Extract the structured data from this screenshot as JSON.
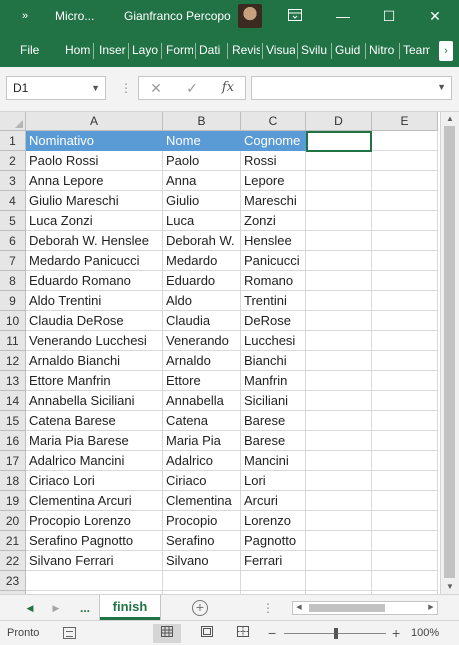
{
  "titlebar": {
    "qat_label": "»",
    "app_title": "Micro...",
    "user_name": "Gianfranco Percopo",
    "ribbon_display_icon": "ribbon-display-icon",
    "minimize_glyph": "—",
    "maximize_glyph": "☐",
    "close_glyph": "✕"
  },
  "ribbon": {
    "tabs": [
      "File",
      "Hom",
      "Inser",
      "Layo",
      "Form",
      "Dati",
      "Revis",
      "Visua",
      "Svilu",
      "Guid",
      "Nitro",
      "Team"
    ],
    "scroll_glyph": "›"
  },
  "formula_bar": {
    "name_box": "D1",
    "cancel_glyph": "✕",
    "enter_glyph": "✓",
    "function_glyph": "fx",
    "formula_value": ""
  },
  "columns": [
    "A",
    "B",
    "C",
    "D",
    "E"
  ],
  "rows": [
    [
      "Nominativo",
      "Nome",
      "Cognome",
      "",
      ""
    ],
    [
      "Paolo Rossi",
      "Paolo",
      "Rossi",
      "",
      ""
    ],
    [
      "Anna Lepore",
      "Anna",
      "Lepore",
      "",
      ""
    ],
    [
      "Giulio Mareschi",
      "Giulio",
      "Mareschi",
      "",
      ""
    ],
    [
      "Luca Zonzi",
      "Luca",
      "Zonzi",
      "",
      ""
    ],
    [
      "Deborah W. Henslee",
      "Deborah W.",
      "Henslee",
      "",
      ""
    ],
    [
      "Medardo Panicucci",
      "Medardo",
      "Panicucci",
      "",
      ""
    ],
    [
      "Eduardo Romano",
      "Eduardo",
      "Romano",
      "",
      ""
    ],
    [
      "Aldo Trentini",
      "Aldo",
      "Trentini",
      "",
      ""
    ],
    [
      "Claudia DeRose",
      "Claudia",
      "DeRose",
      "",
      ""
    ],
    [
      "Venerando Lucchesi",
      "Venerando",
      "Lucchesi",
      "",
      ""
    ],
    [
      "Arnaldo Bianchi",
      "Arnaldo",
      "Bianchi",
      "",
      ""
    ],
    [
      "Ettore Manfrin",
      "Ettore",
      "Manfrin",
      "",
      ""
    ],
    [
      "Annabella Siciliani",
      "Annabella",
      "Siciliani",
      "",
      ""
    ],
    [
      "Catena Barese",
      "Catena",
      "Barese",
      "",
      ""
    ],
    [
      "Maria Pia Barese",
      "Maria Pia",
      "Barese",
      "",
      ""
    ],
    [
      "Adalrico Mancini",
      "Adalrico",
      "Mancini",
      "",
      ""
    ],
    [
      "Ciriaco Lori",
      "Ciriaco",
      "Lori",
      "",
      ""
    ],
    [
      "Clementina Arcuri",
      "Clementina",
      "Arcuri",
      "",
      ""
    ],
    [
      "Procopio Lorenzo",
      "Procopio",
      "Lorenzo",
      "",
      ""
    ],
    [
      "Serafino Pagnotto",
      "Serafino",
      "Pagnotto",
      "",
      ""
    ],
    [
      "Silvano Ferrari",
      "Silvano",
      "Ferrari",
      "",
      ""
    ],
    [
      "",
      "",
      "",
      "",
      ""
    ],
    [
      "",
      "",
      "",
      "",
      ""
    ]
  ],
  "selected_cell": "D1",
  "header_fill_color": "#5b9bd5",
  "accent_color": "#217346",
  "sheets": {
    "prev_glyph": "◀",
    "next_glyph": "▶",
    "more_label": "...",
    "active_sheet": "finish",
    "add_glyph": "+"
  },
  "statusbar": {
    "status": "Pronto",
    "zoom_minus": "−",
    "zoom_plus": "+",
    "zoom": "100%",
    "zoom_level_percent": 100
  }
}
